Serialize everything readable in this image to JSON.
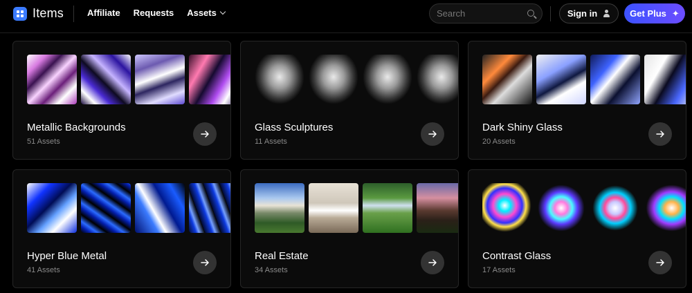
{
  "header": {
    "brand": "Items",
    "nav": [
      "Affiliate",
      "Requests",
      "Assets"
    ],
    "search_placeholder": "Search",
    "signin_label": "Sign in",
    "getplus_label": "Get Plus",
    "getplus_color": "#4f50ff"
  },
  "cards": [
    {
      "title": "Metallic Backgrounds",
      "count": "51 Assets"
    },
    {
      "title": "Glass Sculptures",
      "count": "11 Assets"
    },
    {
      "title": "Dark Shiny Glass",
      "count": "20 Assets"
    },
    {
      "title": "Hyper Blue Metal",
      "count": "41 Assets"
    },
    {
      "title": "Real Estate",
      "count": "34 Assets"
    },
    {
      "title": "Contrast Glass",
      "count": "17 Assets"
    }
  ]
}
